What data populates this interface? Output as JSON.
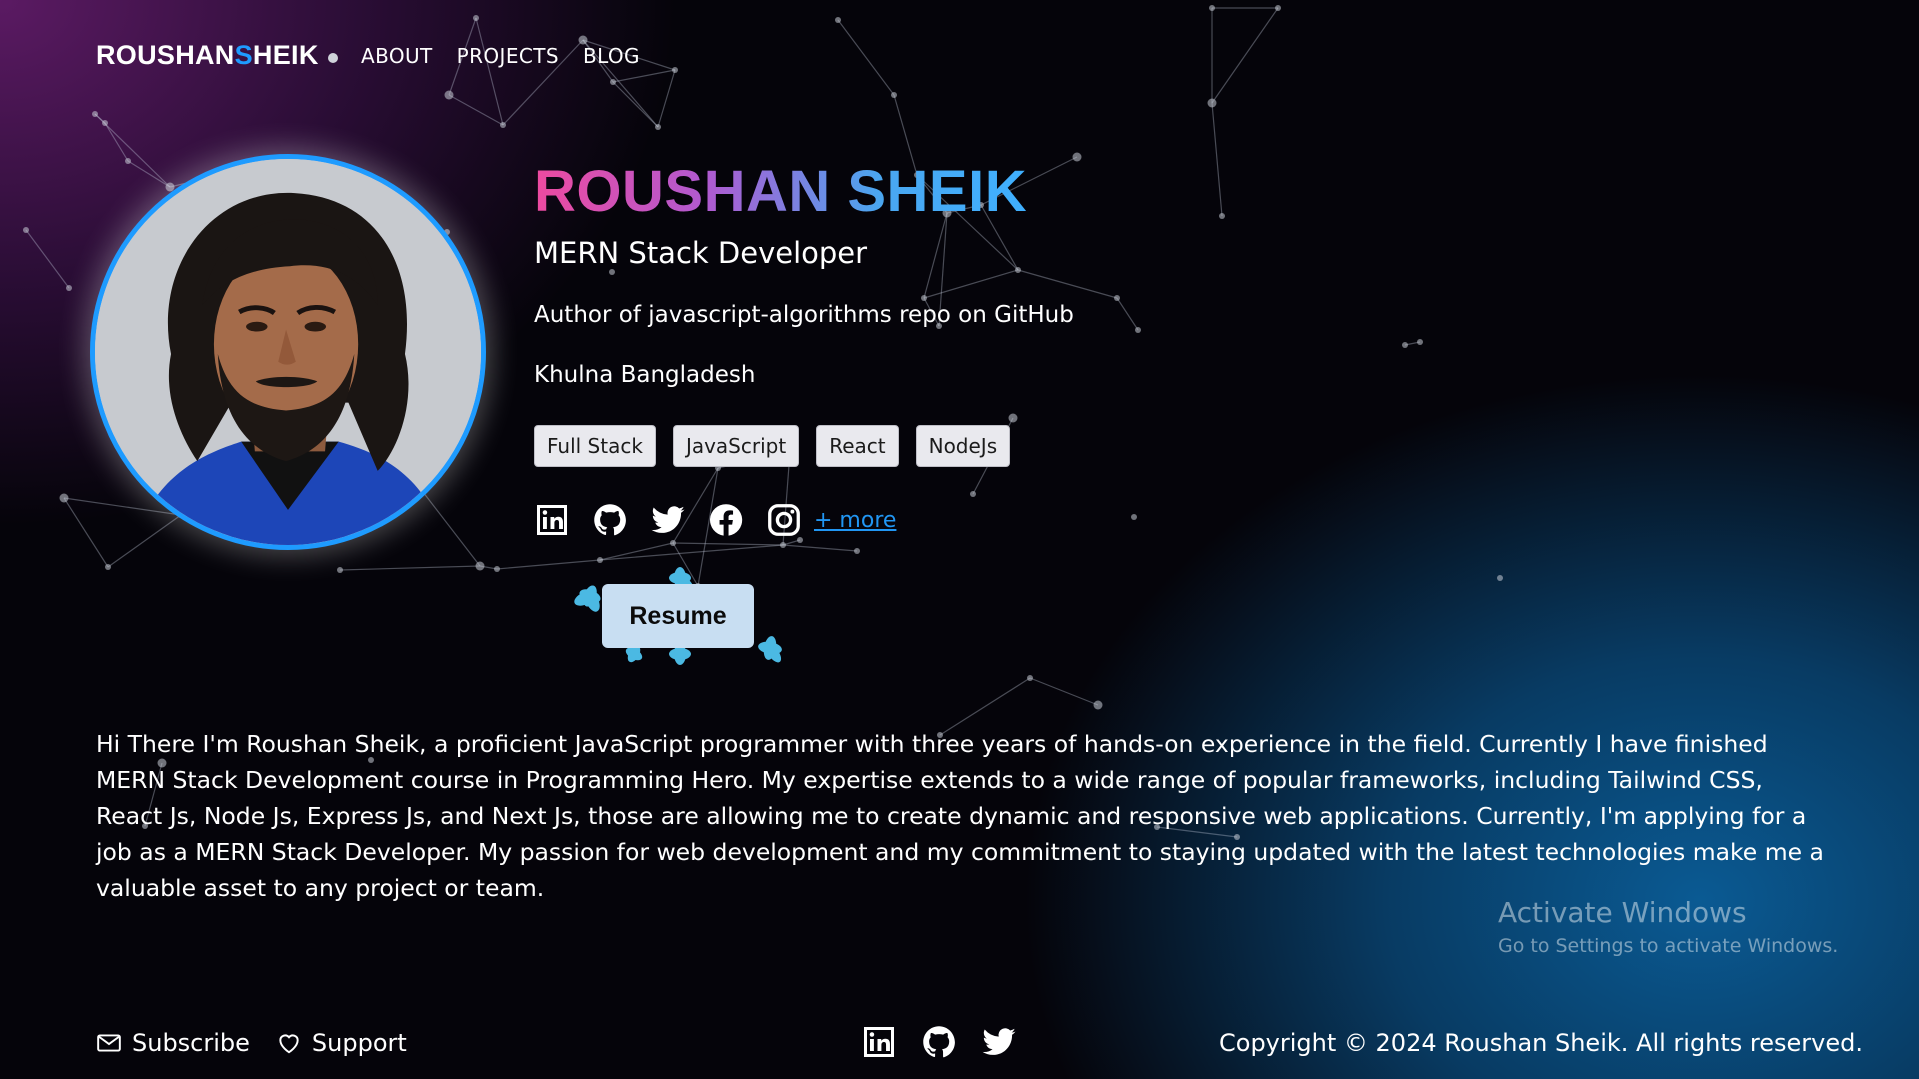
{
  "nav": {
    "brand_part1": "ROUSHAN",
    "brand_accent": "S",
    "brand_part2": "HEIK",
    "links": [
      "ABOUT",
      "PROJECTS",
      "BLOG"
    ]
  },
  "hero": {
    "name": "ROUSHAN SHEIK",
    "role": "MERN Stack Developer",
    "author_line": "Author of javascript-algorithms repo on GitHub",
    "location": "Khulna Bangladesh",
    "tags": [
      "Full Stack",
      "JavaScript",
      "React",
      "NodeJs"
    ],
    "social_icons": [
      "linkedin-icon",
      "github-icon",
      "twitter-icon",
      "facebook-icon",
      "instagram-icon"
    ],
    "more_label": "+ more",
    "resume_label": "Resume"
  },
  "bio": "Hi There I'm Roushan Sheik, a proficient JavaScript programmer with three years of hands-on experience in the field. Currently I have finished MERN Stack Development course in Programming Hero. My expertise extends to a wide range of popular frameworks, including Tailwind CSS, React Js, Node Js, Express Js, and Next Js, those are allowing me to create dynamic and responsive web applications. Currently, I'm applying for a job as a MERN Stack Developer. My passion for web development and my commitment to staying updated with the latest technologies make me a valuable asset to any project or team.",
  "watermark": {
    "title": "Activate Windows",
    "subtitle": "Go to Settings to activate Windows."
  },
  "footer": {
    "subscribe": "Subscribe",
    "support": "Support",
    "social_icons": [
      "linkedin-icon",
      "github-icon",
      "twitter-icon"
    ],
    "copyright": "Copyright © 2024 Roushan Sheik. All rights reserved."
  },
  "colors": {
    "accent": "#1e9bff",
    "link": "#2196f3",
    "name_gradient": [
      "#ee4aa0",
      "#b05ad0",
      "#4aa6f0",
      "#3fb0ff"
    ],
    "tag_bg": "#e9e9ee",
    "resume_bg": "#c8def2"
  }
}
